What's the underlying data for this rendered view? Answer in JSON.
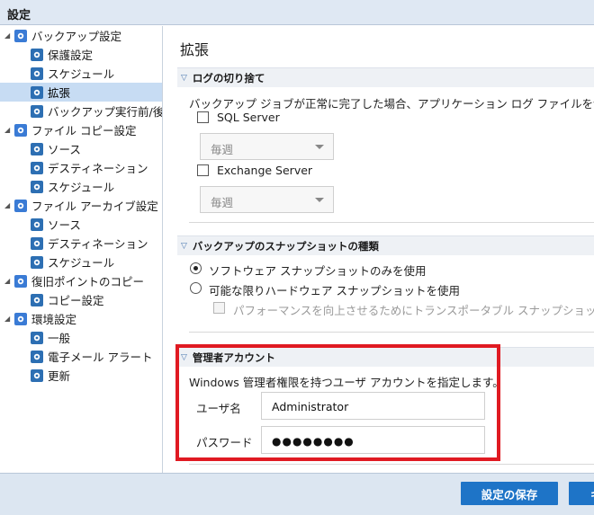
{
  "window": {
    "title": "設定"
  },
  "sidebar": {
    "items": [
      {
        "label": "バックアップ設定",
        "icon": "backup-settings-icon",
        "level": 0
      },
      {
        "label": "保護設定",
        "icon": "protection-icon",
        "level": 1
      },
      {
        "label": "スケジュール",
        "icon": "schedule-icon",
        "level": 1
      },
      {
        "label": "拡張",
        "icon": "advanced-icon",
        "level": 1,
        "selected": true
      },
      {
        "label": "バックアップ実行前/後の",
        "icon": "pre-post-backup-icon",
        "level": 1
      },
      {
        "label": "ファイル コピー設定",
        "icon": "file-copy-settings-icon",
        "level": 0
      },
      {
        "label": "ソース",
        "icon": "source-icon",
        "level": 1
      },
      {
        "label": "デスティネーション",
        "icon": "destination-icon",
        "level": 1
      },
      {
        "label": "スケジュール",
        "icon": "schedule-icon",
        "level": 1
      },
      {
        "label": "ファイル アーカイブ設定",
        "icon": "file-archive-settings-icon",
        "level": 0
      },
      {
        "label": "ソース",
        "icon": "source-icon",
        "level": 1
      },
      {
        "label": "デスティネーション",
        "icon": "destination-icon",
        "level": 1
      },
      {
        "label": "スケジュール",
        "icon": "schedule-icon",
        "level": 1
      },
      {
        "label": "復旧ポイントのコピー",
        "icon": "recovery-point-copy-icon",
        "level": 0
      },
      {
        "label": "コピー設定",
        "icon": "copy-settings-icon",
        "level": 1
      },
      {
        "label": "環境設定",
        "icon": "preferences-icon",
        "level": 0
      },
      {
        "label": "一般",
        "icon": "general-icon",
        "level": 1
      },
      {
        "label": "電子メール アラート",
        "icon": "email-alert-icon",
        "level": 1
      },
      {
        "label": "更新",
        "icon": "update-icon",
        "level": 1
      }
    ]
  },
  "main": {
    "title": "拡張",
    "log_truncation": {
      "header": "ログの切り捨て",
      "description": "バックアップ ジョブが正常に完了した場合、アプリケーション ログ ファイルを切り",
      "sql_label": "SQL Server",
      "sql_select": "毎週",
      "exchange_label": "Exchange Server",
      "exchange_select": "毎週"
    },
    "snapshot": {
      "header": "バックアップのスナップショットの種類",
      "option_software": "ソフトウェア スナップショットのみを使用",
      "option_hardware": "可能な限りハードウェア スナップショットを使用",
      "transportable": "パフォーマンスを向上させるためにトランスポータブル スナップショット"
    },
    "admin": {
      "header": "管理者アカウント",
      "description": "Windows 管理者権限を持つユーザ アカウントを指定します。",
      "username_label": "ユーザ名",
      "username_value": "Administrator",
      "password_label": "パスワード",
      "password_value": "●●●●●●●●"
    }
  },
  "footer": {
    "save_label": "設定の保存",
    "cancel_label": "キ"
  },
  "colors": {
    "accent": "#1e74c7",
    "highlight": "#e01a22",
    "selected": "#c7dcf3"
  }
}
